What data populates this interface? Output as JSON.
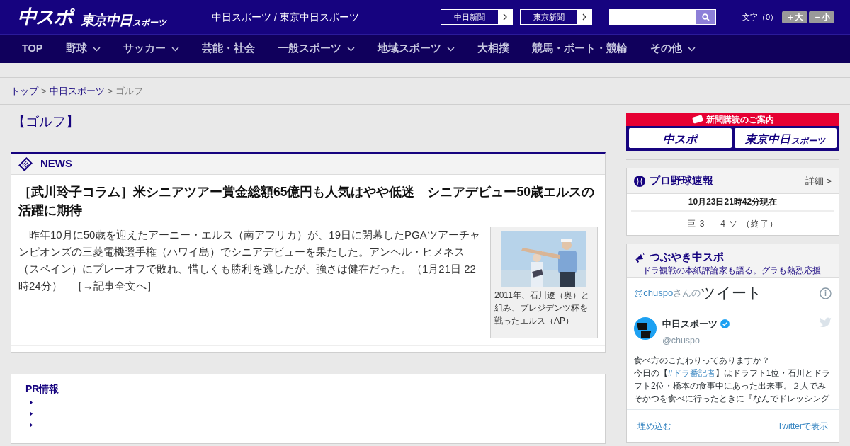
{
  "header": {
    "logo_main": "中スポ",
    "logo_tokyo": "東京中日",
    "logo_tokyo_small": "スポーツ",
    "site_title": "中日スポーツ / 東京中日スポーツ",
    "paper_links": [
      "中日新聞",
      "東京新聞"
    ],
    "font_size_label": "文字（0）",
    "font_buttons": [
      "＋大",
      "－小"
    ]
  },
  "nav": [
    {
      "label": "TOP",
      "has_menu": false
    },
    {
      "label": "野球",
      "has_menu": true
    },
    {
      "label": "サッカー",
      "has_menu": true
    },
    {
      "label": "芸能・社会",
      "has_menu": false
    },
    {
      "label": "一般スポーツ",
      "has_menu": true
    },
    {
      "label": "地域スポーツ",
      "has_menu": true
    },
    {
      "label": "大相撲",
      "has_menu": false
    },
    {
      "label": "競馬・ボート・競輪",
      "has_menu": false
    },
    {
      "label": "その他",
      "has_menu": true
    }
  ],
  "breadcrumb": [
    {
      "label": "トップ",
      "kind": "link"
    },
    {
      "label": ">",
      "kind": "separator"
    },
    {
      "label": "中日スポーツ",
      "kind": "link"
    },
    {
      "label": ">",
      "kind": "separator"
    },
    {
      "label": "ゴルフ",
      "kind": "current"
    }
  ],
  "page_title": "【ゴルフ】",
  "news": {
    "heading": "NEWS",
    "title": "［武川玲子コラム］米シニアツアー賞金総額65億円も人気はやや低迷　シニアデビュー50歳エルスの活躍に期待",
    "body": "昨年10月に50歳を迎えたアーニー・エルス（南アフリカ）が、19日に閉幕したPGAツアーチャンピオンズの三菱電機選手権（ハワイ島）でシニアデビューを果たした。アンヘル・ヒメネス（スペイン）にプレーオフで敗れ、惜しくも勝利を逃したが、強さは健在だった。（1月21日 22時24分）",
    "more_link": "［→記事全文へ］",
    "photo": {
      "kind": "picture",
      "caption": "2011年、石川遼（奥）と組み、プレジデンツ杯を戦ったエルス（AP）"
    }
  },
  "pr": {
    "title": "PR情報",
    "items": [
      {
        "kind": "empty"
      },
      {
        "kind": "empty"
      },
      {
        "kind": "empty"
      }
    ]
  },
  "subscribe": {
    "title": "新聞購読のご案内",
    "logos": [
      "中スポ",
      "東京中日"
    ],
    "logo_small": "スポーツ"
  },
  "baseball": {
    "title": "プロ野球速報",
    "detail_link": "詳細 >",
    "timestamp": "10月23日21時42分現在",
    "games": [
      "巨 3 － 4 ソ （終了）"
    ]
  },
  "tsubuyaki": {
    "title": "つぶやき中スポ",
    "subtitle": "ドラ観戦の本紙評論家も語る。グラも熱烈応援"
  },
  "twitter": {
    "handle_link": "@chuspo",
    "handle_suffix": "さんの",
    "heading": "ツイート",
    "account_name": "中日スポーツ",
    "verified": true,
    "account_handle": "@chuspo",
    "tweet_lines": [
      [
        {
          "kind": "plain",
          "text": "食べ方のこだわりってありますか？"
        }
      ],
      [
        {
          "kind": "plain",
          "text": "今日の【"
        },
        {
          "kind": "hashtag",
          "text": "#ドラ番記者"
        },
        {
          "kind": "plain",
          "text": "】はドラフト1位・石川とドラフト2位・橋本の食事中にあった出来事。２人でみそかつを食べに行ったときに『なんでドレッシング"
        }
      ]
    ],
    "embed_link": "埋め込む",
    "view_link": "Twitterで表示"
  }
}
